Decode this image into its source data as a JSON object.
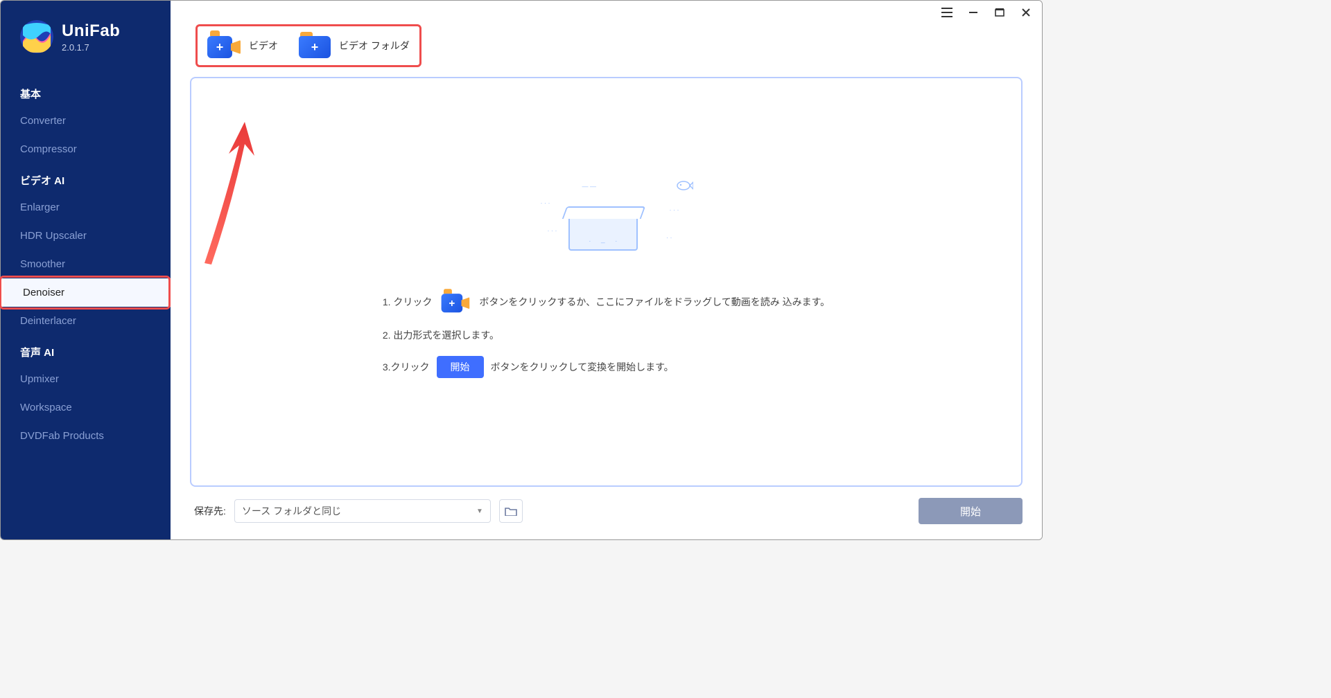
{
  "brand": {
    "name": "UniFab",
    "version": "2.0.1.7"
  },
  "sidebar": {
    "section_basic": "基本",
    "section_video_ai": "ビデオ AI",
    "section_audio_ai": "音声 AI",
    "items": {
      "converter": "Converter",
      "compressor": "Compressor",
      "enlarger": "Enlarger",
      "hdr": "HDR Upscaler",
      "smoother": "Smoother",
      "denoiser": "Denoiser",
      "deinterlacer": "Deinterlacer",
      "upmixer": "Upmixer",
      "workspace": "Workspace",
      "dvdfab": "DVDFab Products"
    }
  },
  "toolbar": {
    "add_video": "ビデオ",
    "add_folder": "ビデオ フォルダ"
  },
  "steps": {
    "s1_pre": "1. クリック",
    "s1_post": "ボタンをクリックするか、ここにファイルをドラッグして動画を読み 込みます。",
    "s2": "2.  出力形式を選択します。",
    "s3_pre": "3.クリック",
    "s3_btn": "開始",
    "s3_post": "ボタンをクリックして変換を開始します。"
  },
  "bottom": {
    "label": "保存先:",
    "value": "ソース フォルダと同じ",
    "start": "開始"
  }
}
